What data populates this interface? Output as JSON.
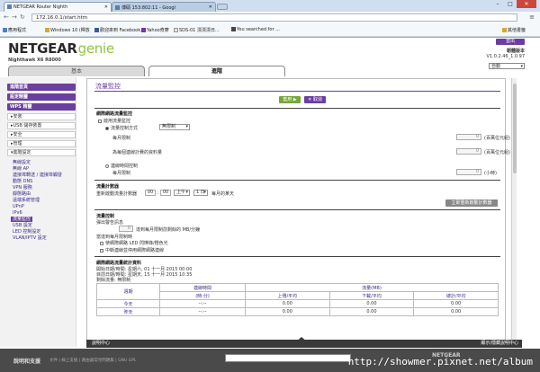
{
  "browser": {
    "tabs": [
      {
        "label": "NETGEAR Router Nighth"
      },
      {
        "label": "博碩 153:802:11 - Googl"
      }
    ],
    "url": "172.16.0.1/start.htm",
    "bookmarks": [
      {
        "label": "應用程式"
      },
      {
        "label": "Windows 10 (釋放"
      },
      {
        "label": "歡迎來到 Facebook..."
      },
      {
        "label": "Yahoo奇摩"
      },
      {
        "label": "SDS-01 漂漂漂日..."
      },
      {
        "label": "You searched for ..."
      },
      {
        "label": "其他書籤"
      }
    ]
  },
  "header": {
    "brand": "NETGEAR",
    "product": "genie",
    "model": "Nighthawk X6 R8000",
    "logout_label": "登出",
    "fw_title": "韌體版本",
    "fw_version": "V1.0.2.46_1.0.97",
    "language": "自動",
    "tabs": [
      {
        "label": "基本"
      },
      {
        "label": "進階"
      }
    ]
  },
  "sidebar": {
    "home": "進階首頁",
    "wizard": "設定精靈",
    "wps": "WPS 精靈",
    "sub_items": [
      {
        "label": "▸安裝"
      },
      {
        "label": "▸USB 儲存裝置"
      },
      {
        "label": "▸安全"
      },
      {
        "label": "▸管理"
      },
      {
        "label": "▾進階設定"
      }
    ],
    "links": [
      {
        "label": "無線設定"
      },
      {
        "label": "無線 AP"
      },
      {
        "label": "連接埠轉送 / 連接埠觸發"
      },
      {
        "label": "動態 DNS"
      },
      {
        "label": "VPN 服務"
      },
      {
        "label": "靜態路由"
      },
      {
        "label": "遠端系統管理"
      },
      {
        "label": "UPnP"
      },
      {
        "label": "IPv6"
      },
      {
        "label": "流量監控"
      },
      {
        "label": "USB 設定"
      },
      {
        "label": "LED 控制設定"
      },
      {
        "label": "VLAN/IPTV 設定"
      }
    ]
  },
  "page": {
    "title": "流量監控",
    "apply_label": "套用 ▶",
    "cancel_label": "✕ 取消",
    "meter": {
      "section": "網際網路流量監控",
      "enable": "啟用流量監控",
      "limit_volume": "流量控制方式",
      "limit_select": "無限制",
      "monthly_limit": "每月限制",
      "monthly_limit_value": "0",
      "monthly_limit_unit": "(百萬位元組)",
      "round_up": "為每個連線計費的資料量",
      "round_up_value": "0",
      "round_up_unit": "(百萬位元組)",
      "connection_time": "連線時間控制",
      "time_limit": "每月限制",
      "time_limit_value": "0",
      "time_limit_unit": "(小時)"
    },
    "counter": {
      "section": "流量計數器",
      "restart": "重新啟動流量計數器",
      "hour": "00",
      "minute": "00",
      "ampm": "上午",
      "day": "1 日",
      "day_suffix": "每月的某天",
      "restart_now": "立即重新啟動計數器"
    },
    "control": {
      "section": "流量控制",
      "popup_before": "彈出警告訊息",
      "popup_value": "0",
      "popup_text": "達到每月限制前剩餘的 MB/分鐘",
      "when_reached": "當達到每月限制時",
      "led": "使網際網路 LED 閃爍綠/橙色光",
      "disconnect": "中斷連線並停用網際網路連線"
    },
    "stats": {
      "section": "網際網路流量統計資料",
      "start_date": "開始日期/時間: 星期六, 01 十一月 2015 00:00",
      "current_date": "目前日期/時間: 星期天, 15 十一月 2015 10:35",
      "remaining": "剩餘流量: 無限制",
      "col_period": "週期",
      "col_conn_time": "連線時間",
      "col_conn_unit": "(時:分)",
      "col_volume": "流量(MB)",
      "col_upload": "上傳/平均",
      "col_download": "下載/平均",
      "col_total": "總計/平均",
      "rows": [
        {
          "period": "今天",
          "time": "--:--",
          "up": "0.00",
          "down": "0.00",
          "total": "0.00"
        },
        {
          "period": "昨天",
          "time": "--:--",
          "up": "0.00",
          "down": "0.00",
          "total": "0.00"
        }
      ]
    }
  },
  "helpbar": {
    "left": "說明中心",
    "right": "顯示/隱藏說明中心"
  },
  "footer": {
    "help": "說明和支援",
    "links": "文件 | 線上支援 | 路由器常見問題集 | GNU GPL",
    "brand": "NETGEAR",
    "watermark": "http://showmer.pixnet.net/album"
  }
}
